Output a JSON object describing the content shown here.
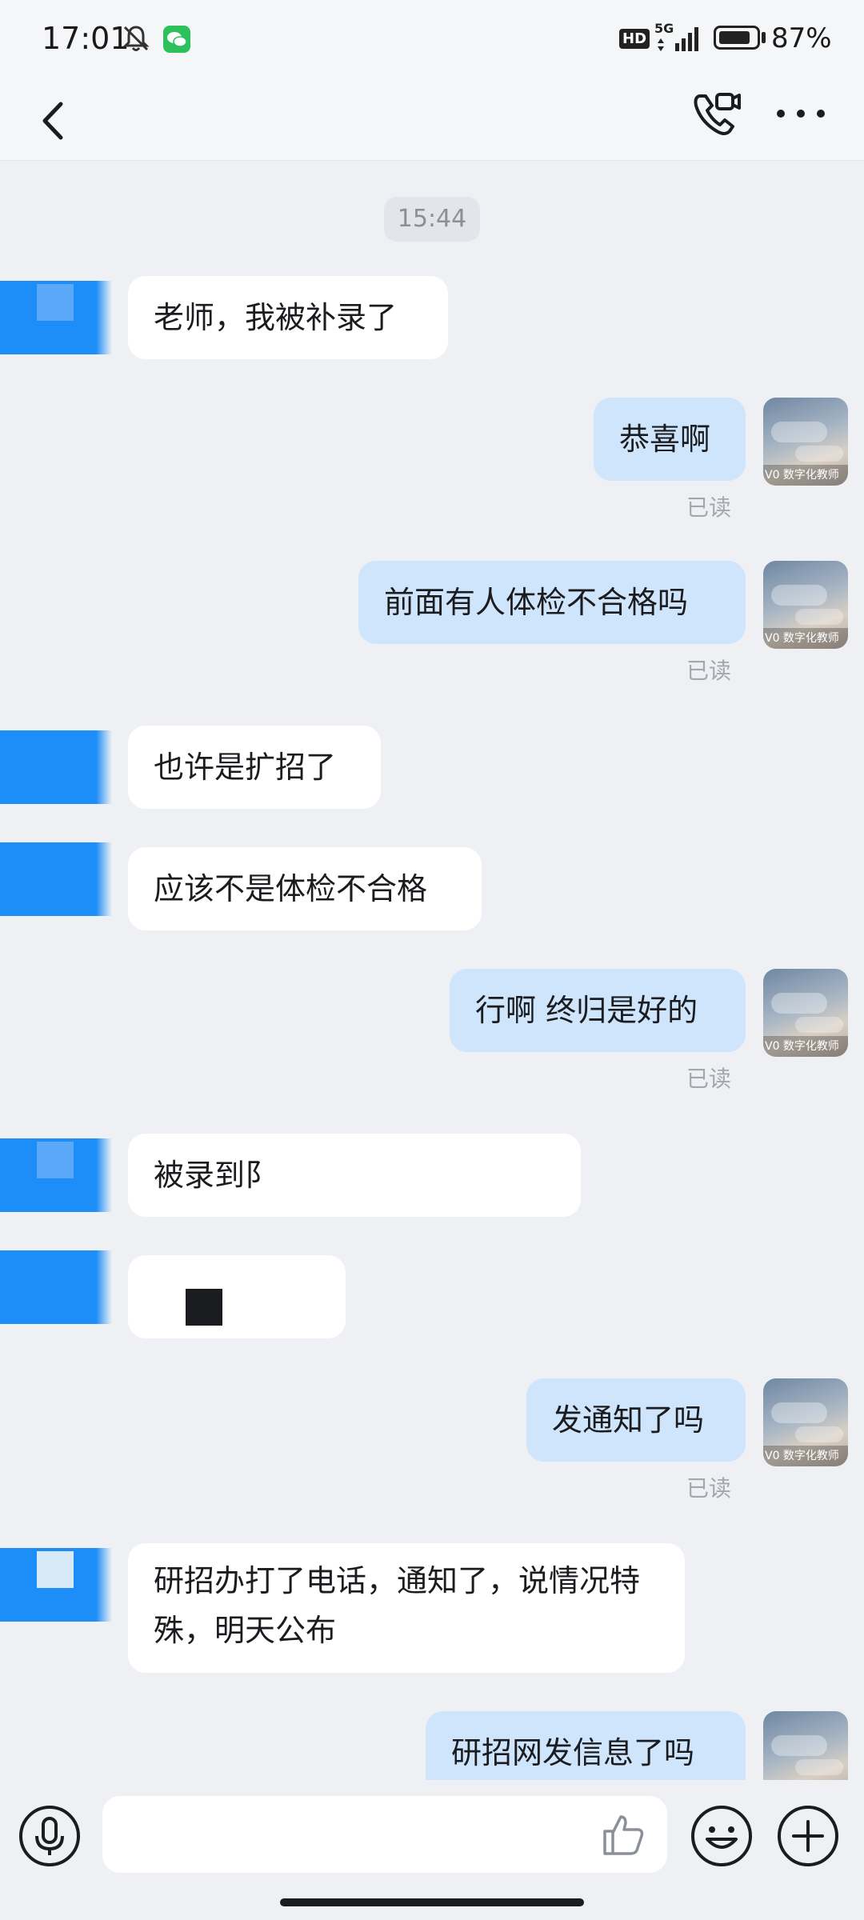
{
  "status_bar": {
    "time": "17:01",
    "hd": "HD",
    "network": "5G",
    "battery": "87%",
    "battery_level": 0.87,
    "icons": [
      "mute-icon",
      "wechat-icon",
      "signal-icon",
      "battery-icon"
    ]
  },
  "nav": {
    "back_icon": "chevron-left-icon",
    "call_icon": "phone-video-icon",
    "more_icon": "more-dots-icon"
  },
  "chat": {
    "timestamp": "15:44",
    "read_label": "已读",
    "avatar_tag": "V0 数字化教师",
    "messages": [
      {
        "dir": "in",
        "text": "老师，我被补录了"
      },
      {
        "dir": "out",
        "text": "恭喜啊"
      },
      {
        "dir": "out",
        "text": "前面有人体检不合格吗"
      },
      {
        "dir": "in",
        "text": "也许是扩招了"
      },
      {
        "dir": "in",
        "text": "应该不是体检不合格"
      },
      {
        "dir": "out",
        "text": "行啊 终归是好的"
      },
      {
        "dir": "in",
        "text": "被录到阝"
      },
      {
        "dir": "in",
        "text": ""
      },
      {
        "dir": "out",
        "text": "发通知了吗"
      },
      {
        "dir": "in",
        "text": "研招办打了电话，通知了，说情况特殊，明天公布"
      },
      {
        "dir": "out",
        "text": "研招网发信息了吗"
      }
    ]
  },
  "input_bar": {
    "voice_icon": "microphone-icon",
    "like_icon": "thumbs-up-icon",
    "emoji_icon": "emoji-icon",
    "plus_icon": "plus-icon"
  },
  "colors": {
    "background": "#eef0f4",
    "incoming_bubble": "#ffffff",
    "outgoing_bubble": "#cfe5fc",
    "avatar_blue": "#1d8df7"
  }
}
